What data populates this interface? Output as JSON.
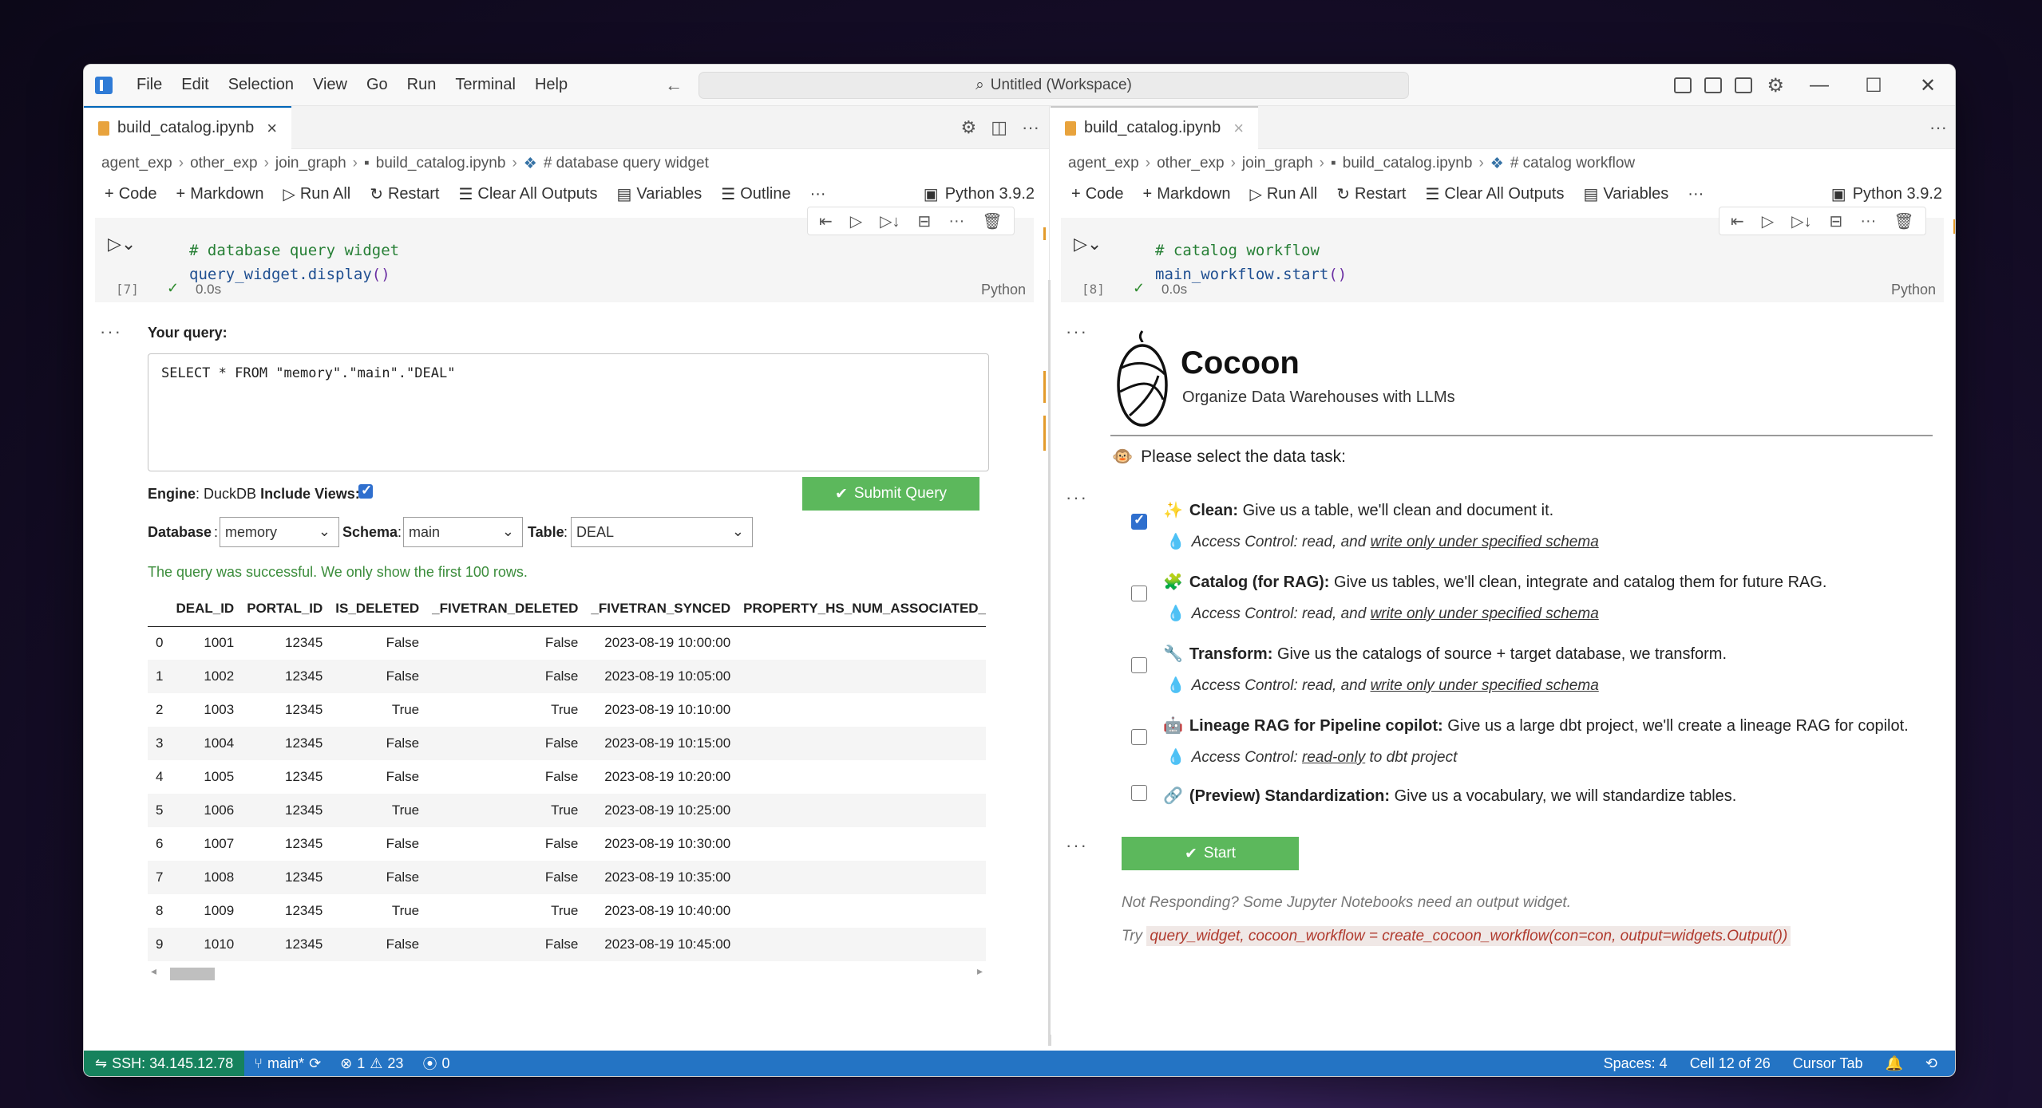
{
  "titlebar": {
    "menu": [
      "File",
      "Edit",
      "Selection",
      "View",
      "Go",
      "Run",
      "Terminal",
      "Help"
    ],
    "search": "Untitled (Workspace)"
  },
  "left": {
    "tab": "build_catalog.ipynb",
    "breadcrumb": [
      "agent_exp",
      "other_exp",
      "join_graph",
      "build_catalog.ipynb",
      "# database query widget"
    ],
    "toolbar": {
      "code": "Code",
      "markdown": "Markdown",
      "run_all": "Run All",
      "restart": "Restart",
      "clear": "Clear All Outputs",
      "variables": "Variables",
      "outline": "Outline",
      "more": "···",
      "kernel": "Python 3.9.2"
    },
    "cell": {
      "comment": "# database query widget",
      "call_ident": "query_widget",
      "call_method": ".display",
      "call_parens": "()",
      "exec_count": "[7]",
      "time": "0.0s",
      "lang": "Python"
    },
    "widget": {
      "query_label": "Your query:",
      "query": "SELECT * FROM \"memory\".\"main\".\"DEAL\"",
      "engine_label": "Engine",
      "engine_value": ": DuckDB",
      "include_views": "Include Views:",
      "submit": "Submit Query",
      "database_label": "Database",
      "database": "memory",
      "schema_label": "Schema",
      "schema": "main",
      "table_label": "Table",
      "table": "DEAL",
      "success": "The query was successful. We only show the first 100 rows."
    },
    "table": {
      "columns": [
        "",
        "DEAL_ID",
        "PORTAL_ID",
        "IS_DELETED",
        "_FIVETRAN_DELETED",
        "_FIVETRAN_SYNCED",
        "PROPERTY_HS_NUM_ASSOCIATED_AC"
      ],
      "rows": [
        [
          "0",
          "1001",
          "12345",
          "False",
          "False",
          "2023-08-19 10:00:00",
          ""
        ],
        [
          "1",
          "1002",
          "12345",
          "False",
          "False",
          "2023-08-19 10:05:00",
          ""
        ],
        [
          "2",
          "1003",
          "12345",
          "True",
          "True",
          "2023-08-19 10:10:00",
          ""
        ],
        [
          "3",
          "1004",
          "12345",
          "False",
          "False",
          "2023-08-19 10:15:00",
          ""
        ],
        [
          "4",
          "1005",
          "12345",
          "False",
          "False",
          "2023-08-19 10:20:00",
          ""
        ],
        [
          "5",
          "1006",
          "12345",
          "True",
          "True",
          "2023-08-19 10:25:00",
          ""
        ],
        [
          "6",
          "1007",
          "12345",
          "False",
          "False",
          "2023-08-19 10:30:00",
          ""
        ],
        [
          "7",
          "1008",
          "12345",
          "False",
          "False",
          "2023-08-19 10:35:00",
          ""
        ],
        [
          "8",
          "1009",
          "12345",
          "True",
          "True",
          "2023-08-19 10:40:00",
          ""
        ],
        [
          "9",
          "1010",
          "12345",
          "False",
          "False",
          "2023-08-19 10:45:00",
          ""
        ]
      ]
    }
  },
  "right": {
    "tab": "build_catalog.ipynb",
    "breadcrumb": [
      "agent_exp",
      "other_exp",
      "join_graph",
      "build_catalog.ipynb",
      "# catalog workflow"
    ],
    "toolbar": {
      "code": "Code",
      "markdown": "Markdown",
      "run_all": "Run All",
      "restart": "Restart",
      "clear": "Clear All Outputs",
      "variables": "Variables",
      "more": "···",
      "kernel": "Python 3.9.2"
    },
    "cell": {
      "comment": "# catalog workflow",
      "call_ident": "main_workflow",
      "call_method": ".start",
      "call_parens": "()",
      "exec_count": "[8]",
      "time": "0.0s",
      "lang": "Python"
    },
    "widget": {
      "title": "Cocoon",
      "subtitle": "Organize Data Warehouses with LLMs",
      "prompt": "Please select the data task:",
      "tasks": [
        {
          "name": "Clean:",
          "desc": "Give us a table, we'll clean and document it.",
          "access_pre": "Access Control: read, and ",
          "access_link": "write only under specified schema",
          "access_post": ""
        },
        {
          "name": "Catalog (for RAG):",
          "desc": "Give us tables, we'll clean, integrate and catalog them for future RAG.",
          "access_pre": "Access Control: read, and ",
          "access_link": "write only under specified schema",
          "access_post": ""
        },
        {
          "name": "Transform:",
          "desc": "Give us the catalogs of source + target database, we transform.",
          "access_pre": "Access Control: read, and ",
          "access_link": "write only under specified schema",
          "access_post": ""
        },
        {
          "name": "Lineage RAG for Pipeline copilot:",
          "desc": "Give us a large dbt project, we'll create a lineage RAG for copilot.",
          "access_pre": "Access Control: ",
          "access_link": "read-only",
          "access_post": " to dbt project"
        },
        {
          "name": "(Preview) Standardization:",
          "desc": "Give us a vocabulary, we will standardize tables."
        }
      ],
      "start": "Start",
      "note1": "Not Responding? Some Jupyter Notebooks need an output widget.",
      "note2_pre": "Try",
      "note2_code": "query_widget, cocoon_workflow = create_cocoon_workflow(con=con, output=widgets.Output())"
    }
  },
  "statusbar": {
    "ssh": "SSH: 34.145.12.78",
    "branch": "main*",
    "errors": "1",
    "warnings": "23",
    "ports": "0",
    "spaces": "Spaces: 4",
    "cell": "Cell 12 of 26",
    "cursor": "Cursor Tab"
  }
}
